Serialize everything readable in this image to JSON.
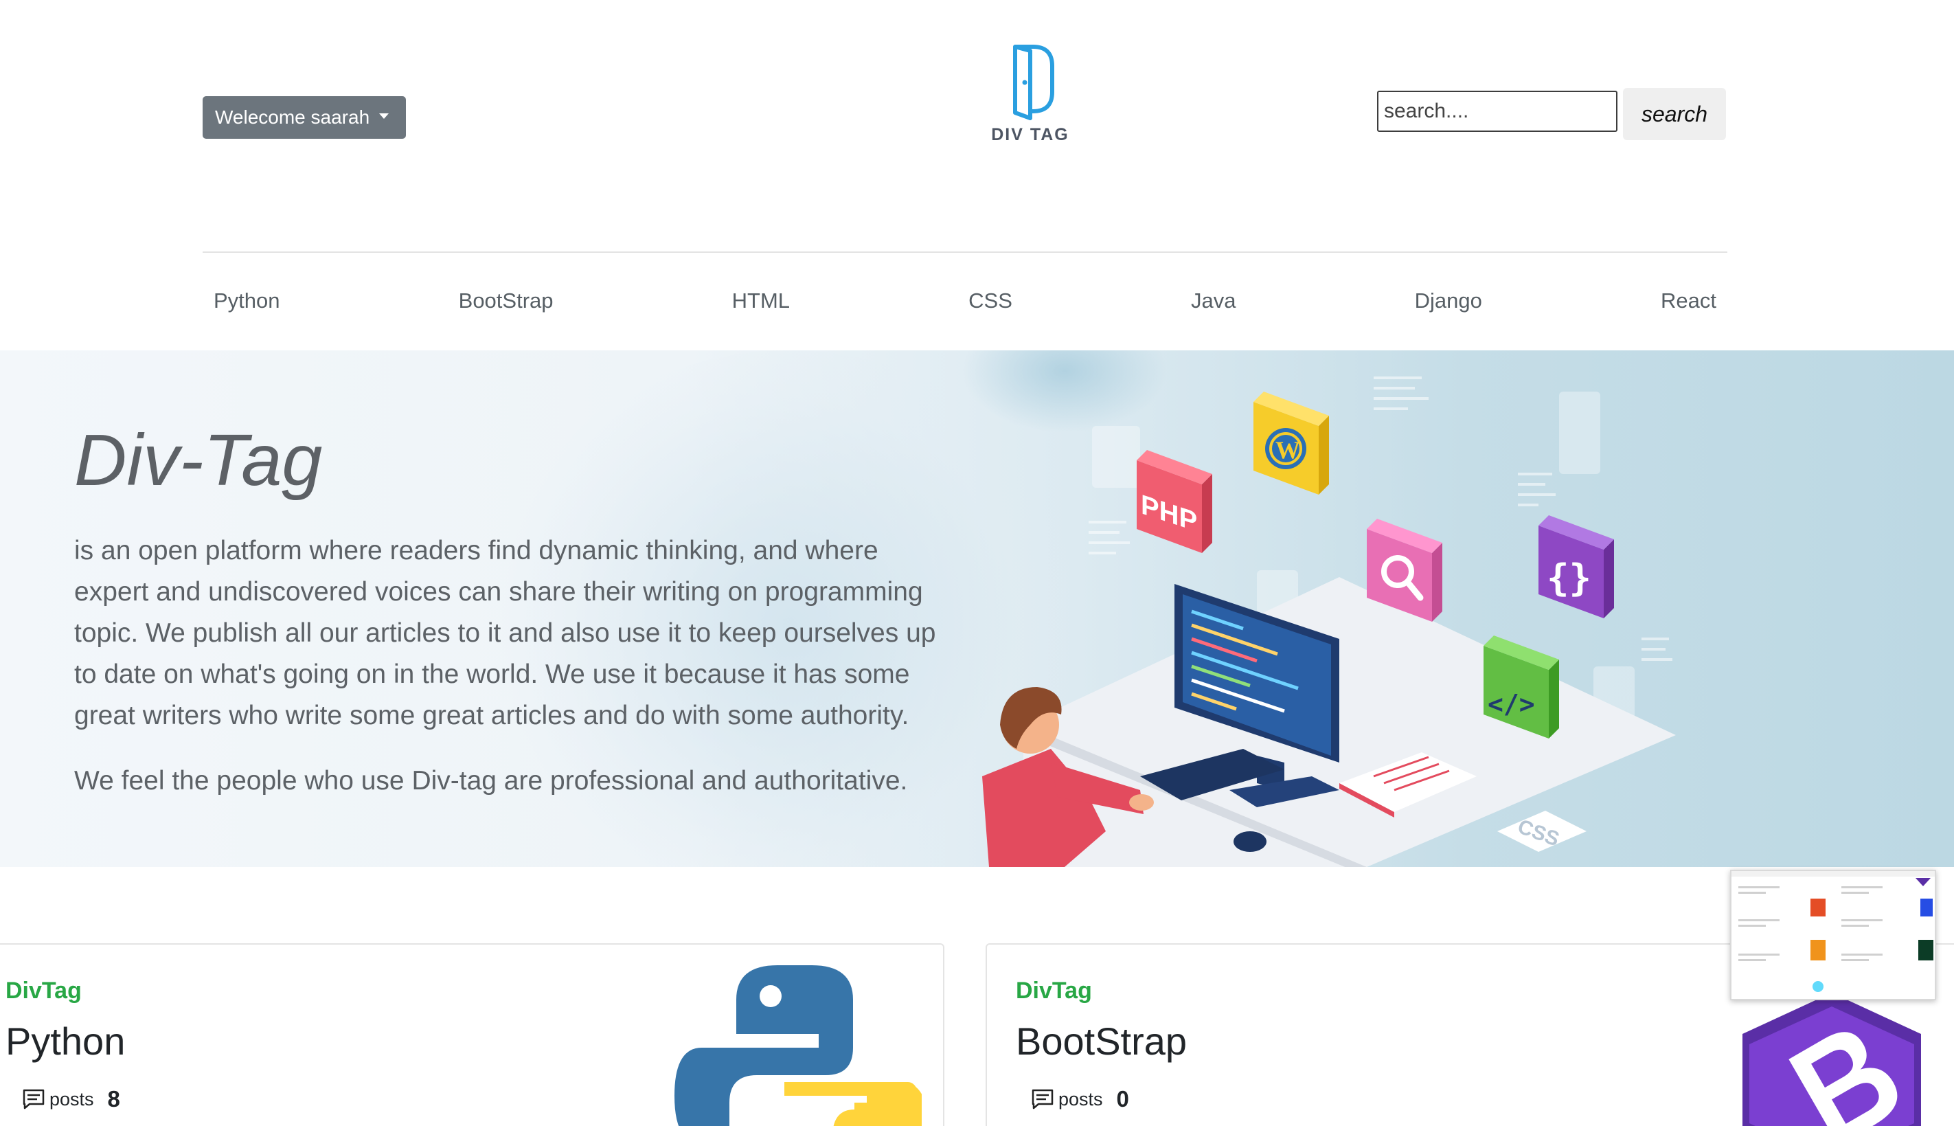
{
  "header": {
    "welcome_label": "Welecome saarah",
    "logo_text": "DIV TAG",
    "search_placeholder": "search....",
    "search_button": "search"
  },
  "nav": {
    "items": [
      "Python",
      "BootStrap",
      "HTML",
      "CSS",
      "Java",
      "Django",
      "React"
    ]
  },
  "hero": {
    "title": "Div-Tag",
    "paragraph1": "is an open platform where readers find dynamic thinking, and where expert and undiscovered voices can share their writing on programming topic. We publish all our articles to it and also use it to keep ourselves up to date on what's going on in the world. We use it because it has some great writers who write some great articles and do with some authority.",
    "paragraph2": "We feel the people who use Div-tag are professional and authoritative.",
    "art_labels": {
      "php": "PHP",
      "css": "CSS"
    }
  },
  "cards": [
    {
      "brand": "DivTag",
      "title": "Python",
      "posts_label": "posts",
      "posts_count": "8",
      "icon": "python-logo"
    },
    {
      "brand": "DivTag",
      "title": "BootStrap",
      "posts_label": "posts",
      "posts_count": "0",
      "icon": "bootstrap-logo"
    }
  ],
  "colors": {
    "brand_green": "#28a745",
    "welcome_bg": "#6c757d",
    "logo_blue": "#2a9fe0",
    "bootstrap_purple": "#7b3fd1"
  }
}
